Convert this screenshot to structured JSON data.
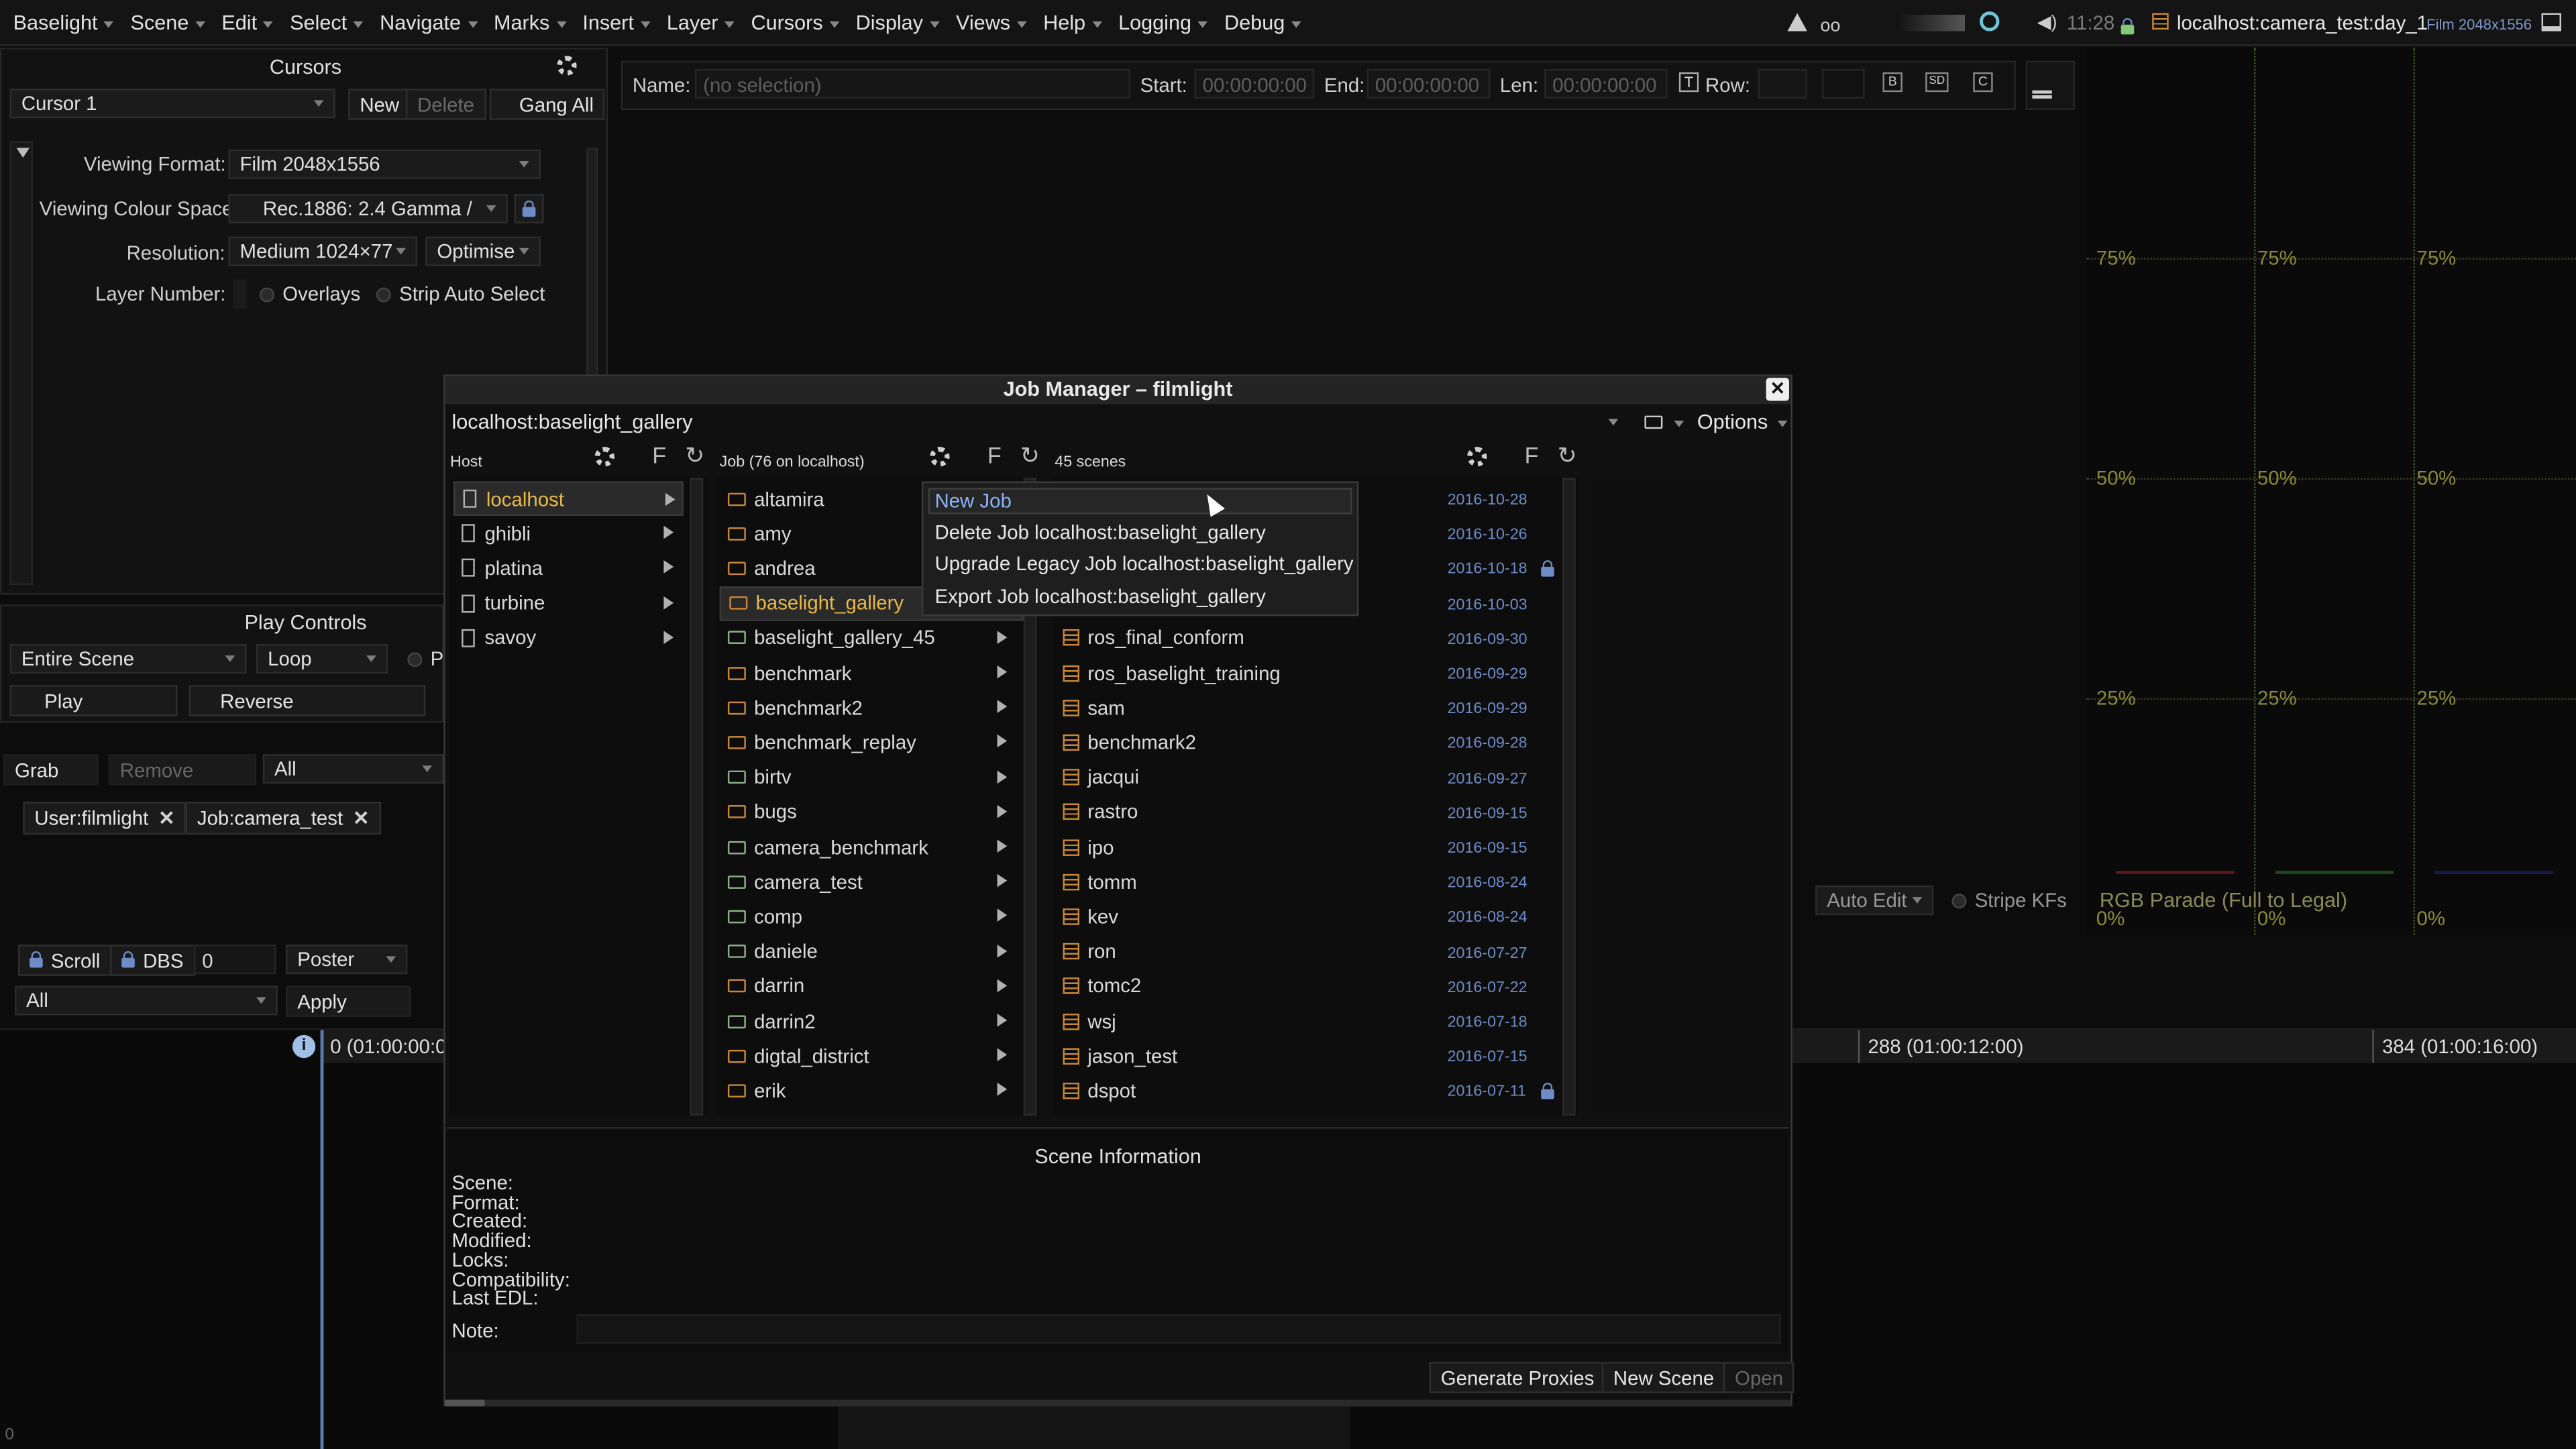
{
  "menubar": {
    "items": [
      "Baselight",
      "Scene",
      "Edit",
      "Select",
      "Navigate",
      "Marks",
      "Insert",
      "Layer",
      "Cursors",
      "Display",
      "Views",
      "Help",
      "Logging",
      "Debug"
    ],
    "time": "11:28",
    "scene_title": "localhost:camera_test:day_1",
    "format_badge": "Film 2048x1556"
  },
  "cursors_panel": {
    "title": "Cursors",
    "cursor_select": "Cursor 1",
    "new_label": "New",
    "delete_label": "Delete",
    "gang_label": "Gang All",
    "viewing_format_label": "Viewing Format:",
    "viewing_format_value": "Film 2048x1556",
    "colour_space_label": "Viewing Colour Space:",
    "colour_space_value": "Rec.1886: 2.4 Gamma /",
    "resolution_label": "Resolution:",
    "resolution_value": "Medium  1024×77",
    "optimise_label": "Optimise",
    "layer_number_label": "Layer Number:",
    "overlays_label": "Overlays",
    "strip_auto_select_label": "Strip Auto Select"
  },
  "play_controls": {
    "title": "Play Controls",
    "range_value": "Entire Scene",
    "loop_value": "Loop",
    "p_label": "P",
    "play_label": "Play",
    "reverse_label": "Reverse"
  },
  "grab_row": {
    "grab": "Grab",
    "remove": "Remove",
    "all": "All"
  },
  "tags": {
    "user": "User:filmlight",
    "job": "Job:camera_test"
  },
  "scroll_row": {
    "scroll": "Scroll",
    "dbs": "DBS",
    "dbs_value": "0",
    "poster": "Poster",
    "all": "All",
    "apply": "Apply"
  },
  "name_bar": {
    "name_label": "Name:",
    "name_placeholder": "(no selection)",
    "start_label": "Start:",
    "start_value": "00:00:00:00",
    "end_label": "End:",
    "end_value": "00:00:00:00",
    "len_label": "Len:",
    "len_value": "00:00:00:00",
    "row_label": "Row:"
  },
  "scope": {
    "p75": "75%",
    "p50": "50%",
    "p25": "25%",
    "p0": "0%",
    "caption": "RGB Parade (Full to Legal)",
    "auto_edit": "Auto Edit",
    "stripe_kfs": "Stripe KFs"
  },
  "timeline": {
    "t0": "0 (01:00:00:0",
    "t288": "288 (01:00:12:00)",
    "t384": "384 (01:00:16:00)",
    "corner": "0"
  },
  "dialog": {
    "title": "Job Manager  –  filmlight",
    "path": "localhost:baselight_gallery",
    "options_label": "Options",
    "host_header": "Host",
    "job_header": "Job (76 on localhost)",
    "scenes_header": "45 scenes",
    "hosts": [
      "localhost",
      "ghibli",
      "platina",
      "turbine",
      "savoy"
    ],
    "jobs": [
      "altamira",
      "amy",
      "andrea",
      "baselight_gallery",
      "baselight_gallery_45",
      "benchmark",
      "benchmark2",
      "benchmark_replay",
      "birtv",
      "bugs",
      "camera_benchmark",
      "camera_test",
      "comp",
      "daniele",
      "darrin",
      "darrin2",
      "digtal_district",
      "erik"
    ],
    "scenes": [
      {
        "name": "",
        "date": "2016-10-28"
      },
      {
        "name": "",
        "date": "2016-10-26"
      },
      {
        "name": "",
        "date": "2016-10-18"
      },
      {
        "name": "",
        "date": "2016-10-03"
      },
      {
        "name": "ros_final_conform",
        "date": "2016-09-30"
      },
      {
        "name": "ros_baselight_training",
        "date": "2016-09-29"
      },
      {
        "name": "sam",
        "date": "2016-09-29"
      },
      {
        "name": "benchmark2",
        "date": "2016-09-28"
      },
      {
        "name": "jacqui",
        "date": "2016-09-27"
      },
      {
        "name": "rastro",
        "date": "2016-09-15"
      },
      {
        "name": "ipo",
        "date": "2016-09-15"
      },
      {
        "name": "tomm",
        "date": "2016-08-24"
      },
      {
        "name": "kev",
        "date": "2016-08-24"
      },
      {
        "name": "ron",
        "date": "2016-07-27"
      },
      {
        "name": "tomc2",
        "date": "2016-07-22"
      },
      {
        "name": "wsj",
        "date": "2016-07-18"
      },
      {
        "name": "jason_test",
        "date": "2016-07-15"
      },
      {
        "name": "dspot",
        "date": "2016-07-11"
      }
    ],
    "context_menu": [
      "New Job",
      "Delete Job localhost:baselight_gallery",
      "Upgrade Legacy Job localhost:baselight_gallery",
      "Export Job localhost:baselight_gallery"
    ],
    "info_title": "Scene Information",
    "info_fields": [
      "Scene:",
      "Format:",
      "Created:",
      "Modified:",
      "Locks:",
      "Compatibility:",
      "Last EDL:"
    ],
    "note_label": "Note:",
    "generate_proxies": "Generate Proxies",
    "new_scene": "New Scene",
    "open": "Open"
  }
}
